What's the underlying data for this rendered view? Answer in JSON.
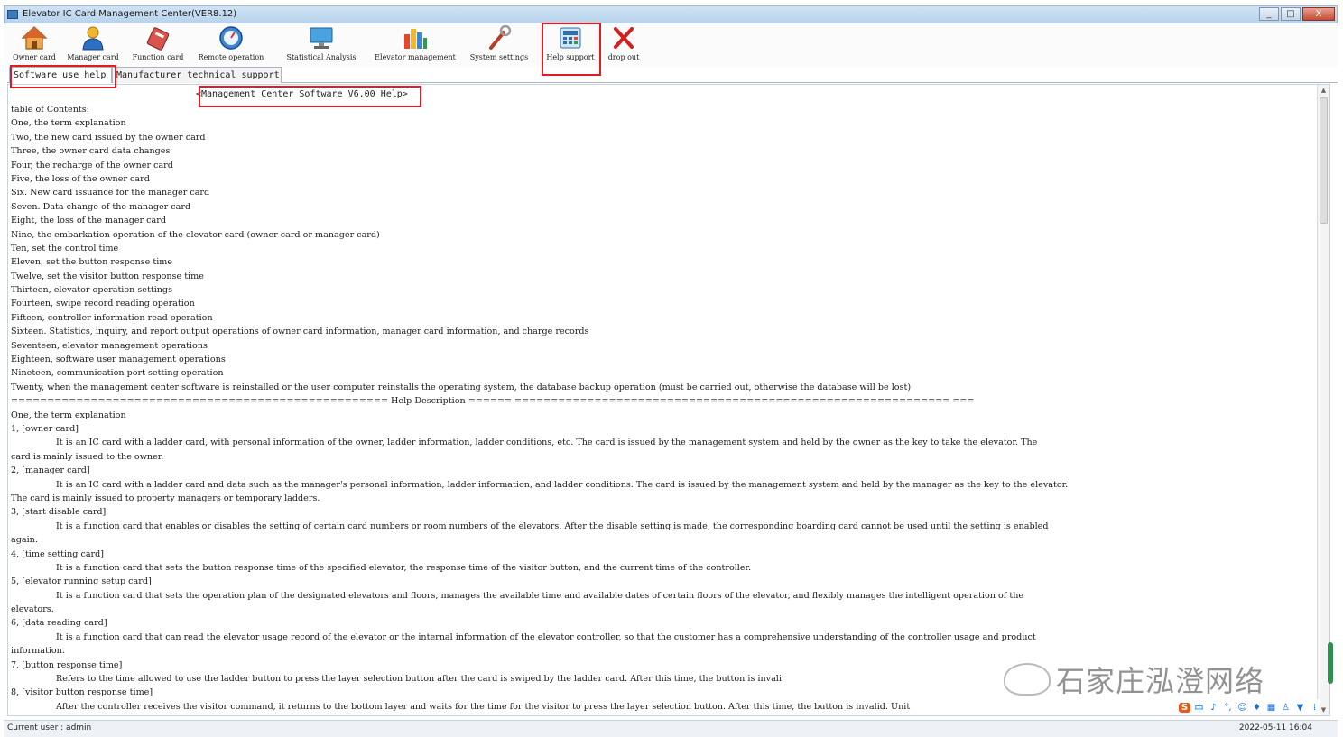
{
  "window": {
    "title": "Elevator IC Card Management Center(VER8.12)",
    "minimize": "_",
    "maximize": "□",
    "close": "X"
  },
  "toolbar": {
    "items": [
      {
        "label": "Owner card",
        "icon": "house-icon"
      },
      {
        "label": "Manager card",
        "icon": "manager-person-icon"
      },
      {
        "label": "Function card",
        "icon": "function-card-icon"
      },
      {
        "label": "Remote operation",
        "icon": "remote-dial-icon"
      },
      {
        "label": "Statistical Analysis",
        "icon": "monitor-icon"
      },
      {
        "label": "Elevator management",
        "icon": "bar-building-icon"
      },
      {
        "label": "System settings",
        "icon": "wrench-icon"
      },
      {
        "label": "Help support",
        "icon": "help-calculator-icon"
      },
      {
        "label": "drop out",
        "icon": "red-x-icon"
      }
    ]
  },
  "tabs": [
    {
      "label": "Software use help"
    },
    {
      "label": "Manufacturer technical support"
    }
  ],
  "content": {
    "help_title": "<Management Center Software V6.00 Help>",
    "lines": [
      {
        "t": "table of Contents:",
        "ind": false
      },
      {
        "t": "One, the term explanation",
        "ind": false
      },
      {
        "t": "Two, the new card issued by the owner card",
        "ind": false
      },
      {
        "t": "Three, the owner card data changes",
        "ind": false
      },
      {
        "t": "Four, the recharge of the owner card",
        "ind": false
      },
      {
        "t": "Five, the loss of the owner card",
        "ind": false
      },
      {
        "t": "Six. New card issuance for the manager card",
        "ind": false
      },
      {
        "t": "Seven. Data change of the manager card",
        "ind": false
      },
      {
        "t": "Eight, the loss of the manager card",
        "ind": false
      },
      {
        "t": "Nine, the embarkation operation of the elevator card (owner card or manager card)",
        "ind": false
      },
      {
        "t": "Ten, set the control time",
        "ind": false
      },
      {
        "t": "Eleven, set the button response time",
        "ind": false
      },
      {
        "t": "Twelve, set the visitor button response time",
        "ind": false
      },
      {
        "t": "Thirteen, elevator operation settings",
        "ind": false
      },
      {
        "t": "Fourteen, swipe record reading operation",
        "ind": false
      },
      {
        "t": "Fifteen, controller information read operation",
        "ind": false
      },
      {
        "t": "Sixteen. Statistics, inquiry, and report output operations of owner card information, manager card information, and charge records",
        "ind": false
      },
      {
        "t": "Seventeen, elevator management operations",
        "ind": false
      },
      {
        "t": "Eighteen, software user management operations",
        "ind": false
      },
      {
        "t": "Nineteen, communication port setting operation",
        "ind": false
      },
      {
        "t": "Twenty, when the management center software is reinstalled or the user computer reinstalls the operating system, the database backup operation (must be carried out, otherwise the database will be lost)",
        "ind": false
      },
      {
        "t": "==================================================== Help Description ====== ============================================================ ===",
        "ind": false
      },
      {
        "t": "One, the term explanation",
        "ind": false
      },
      {
        "t": "1, [owner card]",
        "ind": false
      },
      {
        "t": "It is an IC card with a ladder card, with personal information of the owner, ladder information, ladder conditions, etc. The card is issued by the management system and held by the owner as the key to take the elevator. The",
        "ind": true
      },
      {
        "t": "card is mainly issued to the owner.",
        "ind": false
      },
      {
        "t": "2, [manager card]",
        "ind": false
      },
      {
        "t": "It is an IC card with a ladder card and data such as the manager's personal information, ladder information, and ladder conditions. The card is issued by the management system and held by the manager as the key to the elevator.",
        "ind": true
      },
      {
        "t": "The card is mainly issued to property managers or temporary ladders.",
        "ind": false
      },
      {
        "t": "3, [start disable card]",
        "ind": false
      },
      {
        "t": "It is a function card that enables or disables the setting of certain card numbers or room numbers of the elevators. After the disable setting is made, the corresponding boarding card cannot be used until the setting is enabled",
        "ind": true
      },
      {
        "t": "again.",
        "ind": false
      },
      {
        "t": "4, [time setting card]",
        "ind": false
      },
      {
        "t": "It is a function card that sets the button response time of the specified elevator, the response time of the visitor button, and the current time of the controller.",
        "ind": true
      },
      {
        "t": "5, [elevator running setup card]",
        "ind": false
      },
      {
        "t": "It is a function card that sets the operation plan of the designated elevators and floors, manages the available time and available dates of certain floors of the elevator, and flexibly manages the intelligent operation of the",
        "ind": true
      },
      {
        "t": "elevators.",
        "ind": false
      },
      {
        "t": "6, [data reading card]",
        "ind": false
      },
      {
        "t": "It is a function card that can read the elevator usage record of the elevator or the internal information of the elevator controller, so that the customer has a comprehensive understanding of the controller usage and product",
        "ind": true
      },
      {
        "t": "information.",
        "ind": false
      },
      {
        "t": "7, [button response time]",
        "ind": false
      },
      {
        "t": "Refers to the time allowed to use the ladder button to press the layer selection button after the card is swiped by the ladder card. After this time, the button is invali",
        "ind": true
      },
      {
        "t": "8, [visitor button response time]",
        "ind": false
      },
      {
        "t": "After the controller receives the visitor command, it returns to the bottom layer and waits for the time for the visitor to press the layer selection button. After this time, the button is invalid. Unit",
        "ind": true
      }
    ]
  },
  "watermark": {
    "text": "石家庄泓澄网络"
  },
  "ime": {
    "items": [
      "S",
      "中",
      "♪",
      "°,",
      "☺",
      "♦",
      "▦",
      "♙",
      "▼",
      "⁞"
    ]
  },
  "statusbar": {
    "user": "Current user : admin",
    "datetime": "2022-05-11 16:04"
  },
  "colors": {
    "highlight": "#e01b24"
  }
}
